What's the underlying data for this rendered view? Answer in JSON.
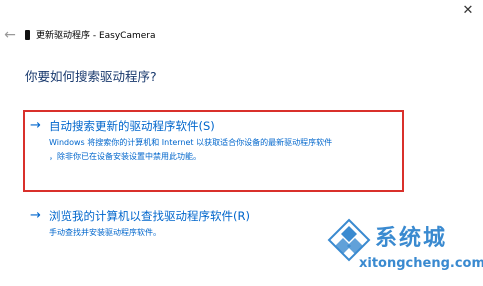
{
  "window": {
    "close_glyph": "✕",
    "back_glyph": "←"
  },
  "title_bar": {
    "title": "更新驱动程序 - EasyCamera"
  },
  "heading": "你要如何搜索驱动程序?",
  "options": [
    {
      "title": "自动搜索更新的驱动程序软件(S)",
      "desc_line1": "Windows 将搜索你的计算机和 Internet 以获取适合你设备的最新驱动程序软件",
      "desc_line2": "，除非你已在设备安装设置中禁用此功能。"
    },
    {
      "title": "浏览我的计算机以查找驱动程序软件(R)",
      "desc_line1": "手动查找并安装驱动程序软件。"
    }
  ],
  "arrow_glyph": "→",
  "watermark": {
    "brand": "系统城",
    "url": "xitongcheng.com"
  },
  "colors": {
    "link": "#0066cc",
    "highlight": "#d9302b",
    "watermark": "#3a8ad0"
  }
}
